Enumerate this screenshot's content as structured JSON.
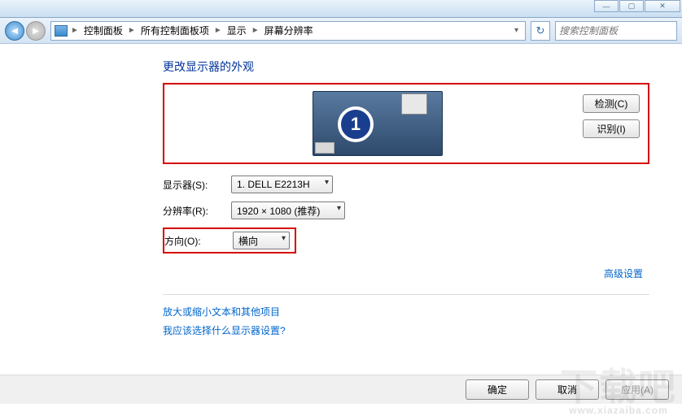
{
  "window_controls": {
    "min": "—",
    "max": "▢",
    "close": "✕"
  },
  "nav": {
    "back_glyph": "◄",
    "fwd_glyph": "►",
    "refresh_glyph": "↻"
  },
  "breadcrumb": {
    "items": [
      "控制面板",
      "所有控制面板项",
      "显示",
      "屏幕分辨率"
    ],
    "sep": "►"
  },
  "search": {
    "placeholder": "搜索控制面板"
  },
  "heading": "更改显示器的外观",
  "monitor_number": "1",
  "preview_buttons": {
    "detect": "检测(C)",
    "identify": "识别(I)"
  },
  "form": {
    "display_label": "显示器(S):",
    "display_value": "1. DELL E2213H",
    "resolution_label": "分辨率(R):",
    "resolution_value": "1920 × 1080 (推荐)",
    "orientation_label": "方向(O):",
    "orientation_value": "横向"
  },
  "advanced_link": "高级设置",
  "help_links": {
    "text_size": "放大或缩小文本和其他项目",
    "which_setting": "我应该选择什么显示器设置?"
  },
  "footer": {
    "ok": "确定",
    "cancel": "取消",
    "apply": "应用(A)"
  },
  "watermark": {
    "main": "下载吧",
    "sub": "www.xiazaiba.com"
  }
}
